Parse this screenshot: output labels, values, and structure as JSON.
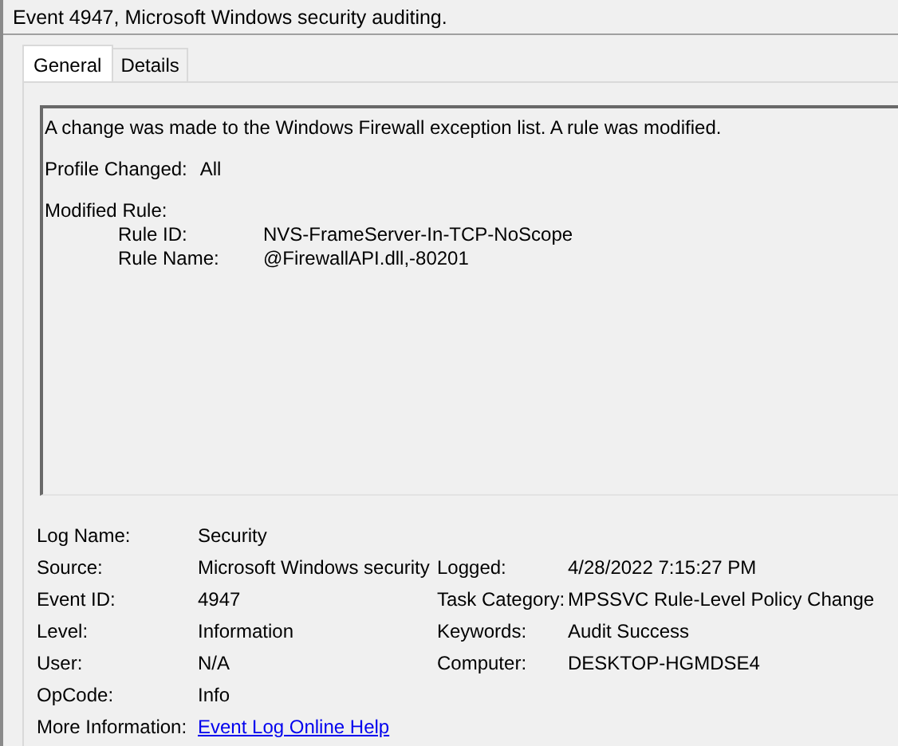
{
  "window": {
    "title": "Event 4947, Microsoft Windows security auditing."
  },
  "tabs": [
    {
      "label": "General",
      "selected": true
    },
    {
      "label": "Details",
      "selected": false
    }
  ],
  "description": {
    "message": "A change was made to the Windows Firewall exception list. A rule was modified.",
    "profile": {
      "label": "Profile Changed:",
      "value": "All"
    },
    "modified_rule": {
      "heading": "Modified Rule:",
      "fields": [
        {
          "label": "Rule ID:",
          "value": "NVS-FrameServer-In-TCP-NoScope"
        },
        {
          "label": "Rule Name:",
          "value": "@FirewallAPI.dll,-80201"
        }
      ]
    }
  },
  "properties": [
    {
      "label": "Log Name:",
      "value": "Security",
      "kind": "text"
    },
    {
      "label": "Source:",
      "value": "Microsoft Windows security",
      "kind": "text",
      "label_2": "Logged:",
      "value_2": "4/28/2022 7:15:27 PM"
    },
    {
      "label": "Event ID:",
      "value": "4947",
      "kind": "text",
      "label_2": "Task Category:",
      "value_2": "MPSSVC Rule-Level Policy Change"
    },
    {
      "label": "Level:",
      "value": "Information",
      "kind": "text",
      "label_2": "Keywords:",
      "value_2": "Audit Success"
    },
    {
      "label": "User:",
      "value": "N/A",
      "kind": "text",
      "label_2": "Computer:",
      "value_2": "DESKTOP-HGMDSE4"
    },
    {
      "label": "OpCode:",
      "value": "Info",
      "kind": "text"
    },
    {
      "label": "More Information:",
      "value": "Event Log Online Help",
      "kind": "link"
    }
  ]
}
